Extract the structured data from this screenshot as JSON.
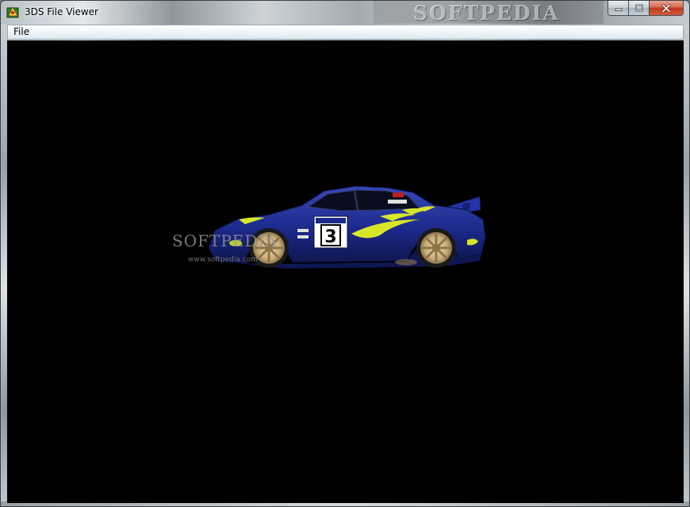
{
  "window": {
    "title": "3DS File Viewer",
    "icon": "3ds-app-icon",
    "watermark": "SOFTPEDIA"
  },
  "caption_buttons": {
    "minimize_icon": "minimize-icon",
    "maximize_icon": "maximize-icon",
    "close_icon": "close-icon"
  },
  "menubar": {
    "items": [
      {
        "label": "File"
      }
    ]
  },
  "viewport": {
    "background": "#000000",
    "model": "rally-car-3d-model",
    "car_number": "3",
    "watermark": "SOFTPEDIA",
    "watermark_url": "www.softpedia.com",
    "colors": {
      "body": "#1d2a8c",
      "accent": "#d8e62a",
      "wheel": "#c9ae7e"
    }
  }
}
